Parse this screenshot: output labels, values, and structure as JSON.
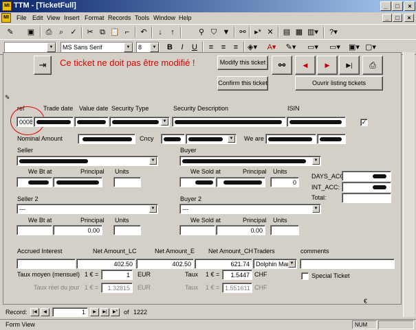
{
  "window": {
    "app_icon": "MI",
    "title": "TTM - [TicketFull]",
    "min": "_",
    "max": "□",
    "close": "×",
    "restore_min": "_",
    "restore_max": "□",
    "restore_close": "×"
  },
  "menu": [
    "File",
    "Edit",
    "View",
    "Insert",
    "Format",
    "Records",
    "Tools",
    "Window",
    "Help"
  ],
  "format_bar": {
    "object": "",
    "font": "MS Sans Serif",
    "size": "8",
    "bold": "B",
    "italic": "I",
    "underline": "U"
  },
  "header": {
    "warning": "Ce ticket ne doit pas être modifié !",
    "modify": "Modify this ticket",
    "confirm": "Confirm this ticket",
    "listing": "Ouvrir listing tickets",
    "exit_icon": "door-exit-icon"
  },
  "labels": {
    "ref": "ref",
    "trade_date": "Trade date",
    "value_date": "Value date",
    "security_type": "Security Type",
    "security_desc": "Security Description",
    "isin": "ISIN",
    "nominal": "Nominal Amount",
    "ccy": "Cncy",
    "we_are": "We are",
    "seller": "Seller",
    "buyer": "Buyer",
    "we_bt_at": "We Bt at",
    "principal": "Principal",
    "units": "Units",
    "we_sold_at": "We Sold at",
    "days_acc": "DAYS_ACC:",
    "int_acc": "INT_ACC:",
    "total": "Total:",
    "seller2": "Seller 2",
    "buyer2": "Buyer 2",
    "accrued": "Accrued Interest",
    "net_lc": "Net Amount_LC",
    "net_e": "Net Amount_E",
    "net_ch": "Net Amount_CH",
    "traders": "Traders",
    "comments": "comments",
    "taux_moyen": "Taux moyen (mensuel)",
    "taux_reel": "Taux réel du jour",
    "one_eur": "1 € =",
    "eur": "EUR",
    "taux": "Taux",
    "chf": "CHF",
    "special": "Special Ticket",
    "euro_sign": "€"
  },
  "values": {
    "ref": "0008",
    "seller2": "---",
    "buyer2": "---",
    "buyer_units": "0",
    "principal2": "0.00",
    "sold_principal2": "0.00",
    "net_lc": "402.50",
    "net_e": "402.50",
    "net_ch": "621.74",
    "trader": "Dolphin Marti",
    "taux_eur_1": "1",
    "taux_chf_1": "1.5447",
    "taux_eur_2": "1.32815",
    "taux_chf_2": "1.551611"
  },
  "nav": {
    "record_label": "Record:",
    "current": "1",
    "of": "of",
    "total": "1222"
  },
  "status": {
    "text": "Form View",
    "num": "NUM"
  }
}
